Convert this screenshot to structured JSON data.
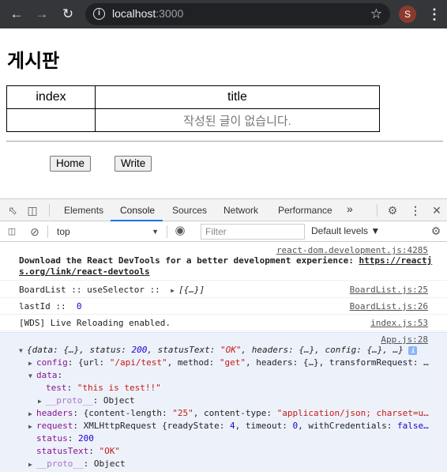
{
  "browser": {
    "url_host": "localhost",
    "url_port": ":3000",
    "profile_initial": "S"
  },
  "page": {
    "title": "게시판",
    "table": {
      "headers": [
        "index",
        "title"
      ],
      "empty_message": "작성된 글이 없습니다."
    },
    "buttons": {
      "home": "Home",
      "write": "Write"
    }
  },
  "devtools": {
    "tabs": [
      "Elements",
      "Console",
      "Sources",
      "Network",
      "Performance"
    ],
    "more_tabs": "»",
    "active_tab": "Console",
    "context": "top",
    "filter_placeholder": "Filter",
    "levels": "Default levels ▼",
    "console": {
      "msg1": {
        "source": "react-dom.development.js:4285",
        "text_a": "Download the React DevTools for a better development experience: ",
        "link_a": "https://reactj",
        "link_b": "s.org/link/react-devtools"
      },
      "msg2": {
        "source": "BoardList.js:25",
        "text": "BoardList :: useSelector ::  ",
        "value": "[{…}]"
      },
      "msg3": {
        "source": "BoardList.js:26",
        "text": "lastId ::  ",
        "value": "0"
      },
      "msg4": {
        "source": "index.js:53",
        "text": "[WDS] Live Reloading enabled."
      },
      "msg5": {
        "source": "App.js:28",
        "summary_a": "{data: {…}, status: ",
        "summary_status": "200",
        "summary_b": ", statusText: ",
        "summary_statustext": "\"OK\"",
        "summary_c": ", headers: {…}, config: {…}, …}",
        "config_key": "config",
        "config_val_a": "{url: ",
        "config_url": "\"/api/test\"",
        "config_val_b": ", method: ",
        "config_method": "\"get\"",
        "config_val_c": ", headers: {…}, transformRequest: …",
        "data_key": "data",
        "test_key": "test",
        "test_val": "\"this is test!!\"",
        "proto_key": "__proto__",
        "proto_val": "Object",
        "headers_key": "headers",
        "headers_val_a": "{content-length: ",
        "headers_len": "\"25\"",
        "headers_val_b": ", content-type: ",
        "headers_type": "\"application/json; charset=u…",
        "request_key": "request",
        "request_val_a": "XMLHttpRequest {readyState: ",
        "request_ready": "4",
        "request_val_b": ", timeout: ",
        "request_timeout": "0",
        "request_val_c": ", withCredentials: ",
        "request_cred": "false…",
        "status_key": "status",
        "status_val": "200",
        "statustext_key": "statusText",
        "statustext_val": "\"OK\"",
        "proto2_key": "__proto__",
        "proto2_val": "Object"
      }
    }
  }
}
